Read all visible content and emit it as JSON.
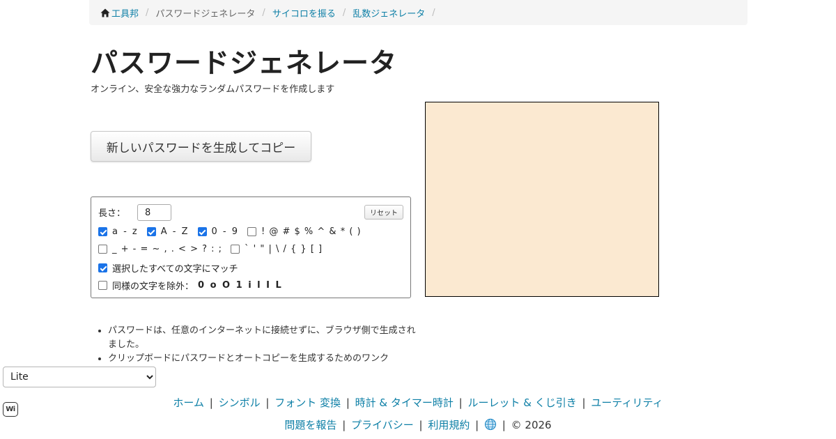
{
  "breadcrumb": {
    "home": "工具邦",
    "current": "パスワードジェネレータ",
    "link1": "サイコロを振る",
    "link2": "乱数ジェネレータ"
  },
  "page": {
    "title": "パスワードジェネレータ",
    "subtitle": "オンライン、安全な強力なランダムパスワードを作成します"
  },
  "generate_button": "新しいパスワードを生成してコピー",
  "options": {
    "length_label": "長さ：",
    "length_value": "8",
    "reset_label": "リセット",
    "lowercase": {
      "label": "a - z",
      "checked": true
    },
    "uppercase": {
      "label": "A - Z",
      "checked": true
    },
    "digits": {
      "label": "0 - 9",
      "checked": true
    },
    "symbols1": {
      "label": "! @ # $ % ^ & * ( )",
      "checked": false
    },
    "symbols2": {
      "label": "_ + - = ~ , . < > ? : ;",
      "checked": false
    },
    "symbols3": {
      "label": "` ' \" | \\ / { } [ ]",
      "checked": false
    },
    "match_all": {
      "label": "選択したすべての文字にマッチ",
      "checked": true
    },
    "exclude_similar": {
      "label": "同様の文字を除外：",
      "chars": "0 o O 1 i l I L",
      "checked": false
    }
  },
  "notes": [
    "パスワードは、任意のインターネットに接続せずに、ブラウザ側で生成されました。",
    "クリップボードにパスワードとオートコピーを生成するためのワンク"
  ],
  "language_select": {
    "value": "Lite"
  },
  "footer": {
    "row1": [
      "ホーム",
      "シンボル",
      "フォント 変換",
      "時計 & タイマー時計",
      "ルーレット & くじ引き",
      "ユーティリティ"
    ],
    "row2": [
      "問題を報告",
      "プライバシー",
      "利用規約"
    ],
    "copyright": "© 2026",
    "separator": "|"
  },
  "colors": {
    "link": "#0d7fa6",
    "ad_background": "#fbe9d1",
    "checkbox_checked": "#1a73e8"
  },
  "icons": {
    "home": "home-icon",
    "globe": "globe-icon",
    "wi": "wi-icon"
  },
  "wi_label": "Wi"
}
